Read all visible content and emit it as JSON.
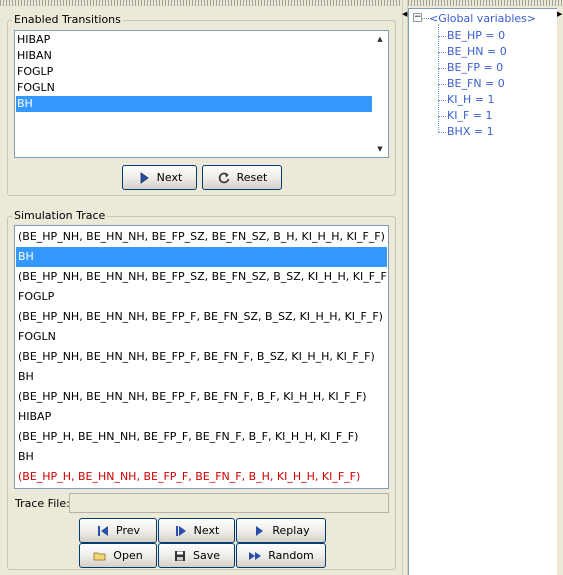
{
  "enabled_transitions": {
    "title": "Enabled Transitions",
    "items": [
      "HIBAP",
      "HIBAN",
      "FOGLP",
      "FOGLN",
      "BH"
    ],
    "selected_index": 4,
    "next_label": "Next",
    "reset_label": "Reset"
  },
  "simulation_trace": {
    "title": "Simulation Trace",
    "rows": [
      "(BE_HP_NH, BE_HN_NH, BE_FP_SZ, BE_FN_SZ, B_H, KI_H_H, KI_F_F)",
      "BH",
      "(BE_HP_NH, BE_HN_NH, BE_FP_SZ, BE_FN_SZ, B_SZ, KI_H_H, KI_F_F)",
      "FOGLP",
      "(BE_HP_NH, BE_HN_NH, BE_FP_F, BE_FN_SZ, B_SZ, KI_H_H, KI_F_F)",
      "FOGLN",
      "(BE_HP_NH, BE_HN_NH, BE_FP_F, BE_FN_F, B_SZ, KI_H_H, KI_F_F)",
      "BH",
      "(BE_HP_NH, BE_HN_NH, BE_FP_F, BE_FN_F, B_F, KI_H_H, KI_F_F)",
      "HIBAP",
      "(BE_HP_H, BE_HN_NH, BE_FP_F, BE_FN_F, B_F, KI_H_H, KI_F_F)",
      "BH",
      "(BE_HP_H, BE_HN_NH, BE_FP_F, BE_FN_F, B_H, KI_H_H, KI_F_F)"
    ],
    "selected_index": 1,
    "highlight_index": 12,
    "highlight_color": "#d00000",
    "selection_color": "#3399ff"
  },
  "trace_file": {
    "label": "Trace File:",
    "value": ""
  },
  "buttons": {
    "prev": "Prev",
    "next": "Next",
    "replay": "Replay",
    "open": "Open",
    "save": "Save",
    "random": "Random"
  },
  "tree": {
    "expander": "−",
    "root": "<Global variables>",
    "children": [
      "BE_HP = 0",
      "BE_HN = 0",
      "BE_FP = 0",
      "BE_FN = 0",
      "KI_H = 1",
      "KI_F = 1",
      "BHX = 1"
    ]
  },
  "icons": {
    "next": "play-triangle-icon",
    "reset": "circular-arrow-icon",
    "prev": "skip-back-icon",
    "step": "skip-forward-icon",
    "replay": "play-icon",
    "open": "folder-icon",
    "save": "floppy-disk-icon",
    "random": "fast-forward-icon"
  }
}
